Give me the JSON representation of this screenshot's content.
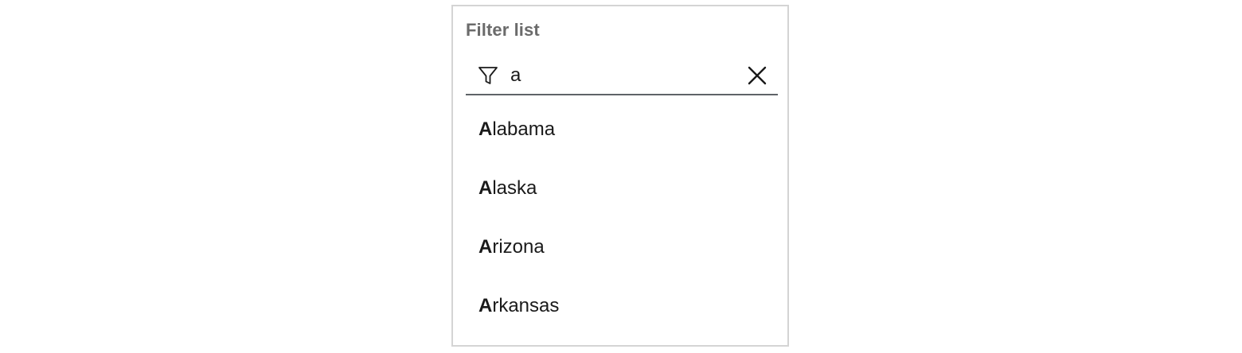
{
  "filter": {
    "label": "Filter list",
    "value": "a",
    "placeholder": ""
  },
  "icons": {
    "filter": "filter-icon",
    "clear": "close-icon"
  },
  "results": [
    {
      "match": "A",
      "rest": "labama"
    },
    {
      "match": "A",
      "rest": "laska"
    },
    {
      "match": "A",
      "rest": "rizona"
    },
    {
      "match": "A",
      "rest": "rkansas"
    }
  ]
}
